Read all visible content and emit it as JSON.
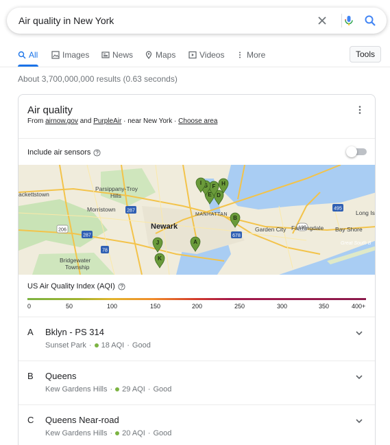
{
  "search": {
    "query": "Air quality in New York"
  },
  "tabs": [
    {
      "label": "All",
      "icon": "search-icon",
      "active": true
    },
    {
      "label": "Images",
      "icon": "image-icon"
    },
    {
      "label": "News",
      "icon": "news-icon"
    },
    {
      "label": "Maps",
      "icon": "map-pin-icon"
    },
    {
      "label": "Videos",
      "icon": "video-icon"
    },
    {
      "label": "More",
      "icon": "more-vert-icon"
    }
  ],
  "tools_label": "Tools",
  "results_count": "About 3,700,000,000 results (0.63 seconds)",
  "card": {
    "title": "Air quality",
    "source_from": "From",
    "source_1": "airnow.gov",
    "source_and": "and",
    "source_2": "PurpleAir",
    "source_near": "· near New York ·",
    "choose_area": "Choose area",
    "sensors_label": "Include air sensors",
    "sensors_on": false
  },
  "map": {
    "labels": {
      "hackettstown": "ackettstown",
      "parsippany": "Parsippany-Troy",
      "hills": "Hills",
      "morristown": "Morristown",
      "newark": "Newark",
      "manhattan": "MANHATTAN",
      "bridgewater": "Bridgewater",
      "township": "Township",
      "garden_city": "Garden City",
      "farmingdale": "Farmingdale",
      "bay_shore": "Bay Shore",
      "long_is": "Long Is",
      "great_south": "Great South B",
      "r206": "206",
      "r287a": "287",
      "r287b": "287",
      "r78": "78",
      "r495": "495",
      "r135": "135",
      "r678": "678"
    },
    "markers": [
      "A",
      "B",
      "D",
      "E",
      "F",
      "G",
      "H",
      "I",
      "J",
      "K"
    ]
  },
  "aqi": {
    "label": "US Air Quality Index (AQI)",
    "ticks": [
      "0",
      "50",
      "100",
      "150",
      "200",
      "250",
      "300",
      "350",
      "400+"
    ]
  },
  "stations": [
    {
      "letter": "A",
      "name": "Bklyn - PS 314",
      "area": "Sunset Park",
      "aqi": "18 AQI",
      "status": "Good"
    },
    {
      "letter": "B",
      "name": "Queens",
      "area": "Kew Gardens Hills",
      "aqi": "29 AQI",
      "status": "Good"
    },
    {
      "letter": "C",
      "name": "Queens Near-road",
      "area": "Kew Gardens Hills",
      "aqi": "20 AQI",
      "status": "Good"
    }
  ],
  "colors": {
    "accent": "#1a73e8",
    "good": "#7cb342",
    "marker": "#6a9a3a"
  }
}
